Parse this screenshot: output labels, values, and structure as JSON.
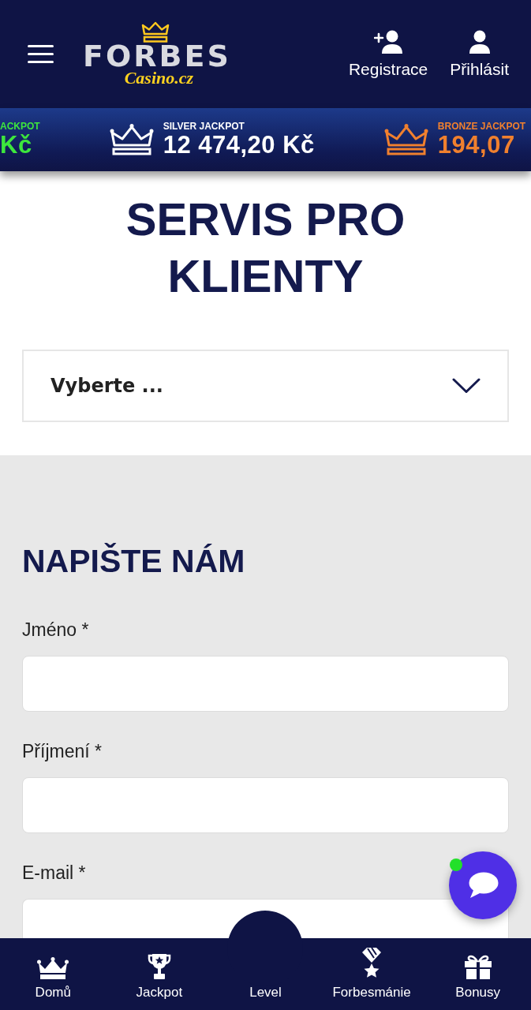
{
  "header": {
    "logo": {
      "wordmark": "FORBES",
      "tagline": "Casino.cz"
    },
    "actions": [
      {
        "kind": "register",
        "label": "Registrace"
      },
      {
        "kind": "login",
        "label": "Přihlásit"
      }
    ]
  },
  "jackpot_bar": {
    "jackpots": [
      {
        "label": "ACKPOT",
        "amount": "Kč",
        "color": "#3de63d",
        "crown": false
      },
      {
        "label": "SILVER JACKPOT",
        "amount": "12 474,20 Kč",
        "color": "#ffffff",
        "crown": true
      },
      {
        "label": "BRONZE JACKPOT",
        "amount": "194,07",
        "color": "#f0802e",
        "crown": true
      }
    ]
  },
  "page_title": "SERVIS PRO KLIENTY",
  "topic_select": {
    "placeholder": "Vyberte ..."
  },
  "contact_form": {
    "title": "NAPIŠTE NÁM",
    "fields": [
      {
        "label": "Jméno *"
      },
      {
        "label": "Příjmení *"
      },
      {
        "label": "E-mail *"
      }
    ]
  },
  "bottom_nav": {
    "items": [
      {
        "kind": "crown",
        "label": "Domů"
      },
      {
        "kind": "trophy",
        "label": "Jackpot"
      },
      {
        "kind": "center",
        "label": "Level"
      },
      {
        "kind": "medal",
        "label": "Forbesmánie"
      },
      {
        "kind": "gift",
        "label": "Bonusy"
      }
    ]
  },
  "chat": {
    "online": true
  }
}
